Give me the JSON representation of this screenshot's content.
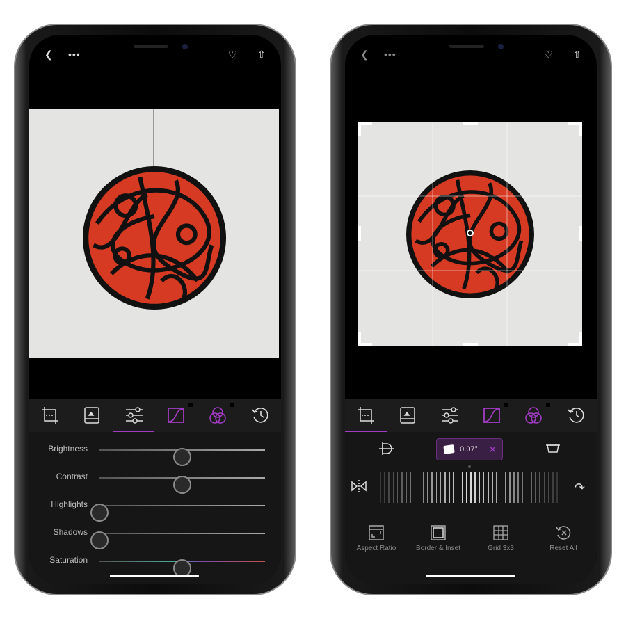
{
  "accent": "#a23bc4",
  "left": {
    "top_icons": [
      "back-icon",
      "more-icon",
      "heart-icon",
      "share-icon"
    ],
    "tools": [
      "crop-icon",
      "image-icon",
      "adjust-sliders-icon",
      "curves-icon",
      "color-mix-icon",
      "history-icon"
    ],
    "active_tool": "adjust-sliders-icon",
    "locked_tools": [
      "curves-icon",
      "color-mix-icon"
    ],
    "sliders": [
      {
        "label": "Brightness",
        "value": 0.5
      },
      {
        "label": "Contrast",
        "value": 0.5
      },
      {
        "label": "Highlights",
        "value": 0
      },
      {
        "label": "Shadows",
        "value": 0
      },
      {
        "label": "Saturation",
        "value": 0.5
      }
    ]
  },
  "right": {
    "active_tool": "crop-icon",
    "straighten_value": "0.07°",
    "buttons": [
      {
        "label": "Aspect Ratio",
        "icon": "aspect-ratio-icon"
      },
      {
        "label": "Border & Inset",
        "icon": "border-icon"
      },
      {
        "label": "Grid 3x3",
        "icon": "grid-icon"
      },
      {
        "label": "Reset All",
        "icon": "reset-icon"
      }
    ]
  }
}
